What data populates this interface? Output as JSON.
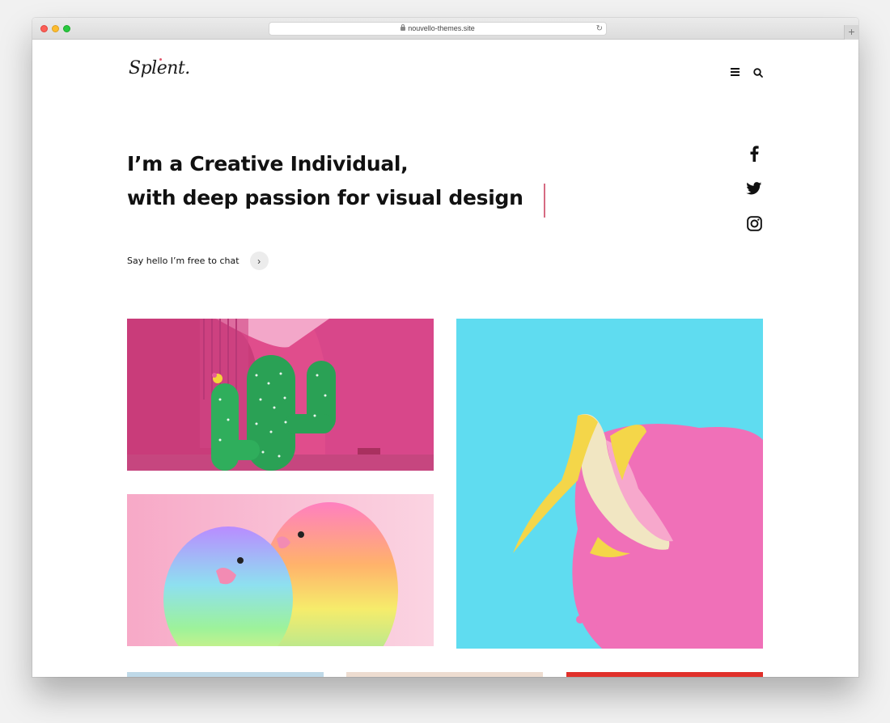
{
  "browser": {
    "url": "nouvello-themes.site",
    "reload_icon": "reload-icon",
    "new_tab_label": "+"
  },
  "site": {
    "logo": "Splent.",
    "menu_icon": "hamburger-menu-icon",
    "search_icon": "search-icon"
  },
  "hero": {
    "line1": "I’m a Creative Individual,",
    "line2": "with deep passion for visual design"
  },
  "social": [
    {
      "name": "facebook-icon"
    },
    {
      "name": "twitter-icon"
    },
    {
      "name": "instagram-icon"
    }
  ],
  "cta": {
    "text": "Say hello I’m free to chat",
    "button_icon": "chevron-right-icon",
    "button_glyph": "›"
  },
  "portfolio": [
    {
      "name": "portfolio-item-cactus",
      "subject": "inflatable cactus on pink wall"
    },
    {
      "name": "portfolio-item-banana",
      "subject": "banana on pink puddle over cyan"
    },
    {
      "name": "portfolio-item-parrots",
      "subject": "rainbow lovebirds"
    },
    {
      "name": "portfolio-item-bottom-1"
    },
    {
      "name": "portfolio-item-bottom-2"
    },
    {
      "name": "portfolio-item-bottom-3"
    }
  ],
  "colors": {
    "accent": "#d66b82",
    "text": "#111111",
    "cyan": "#5fdcf0",
    "pink": "#f070b8",
    "red": "#e0302a"
  }
}
